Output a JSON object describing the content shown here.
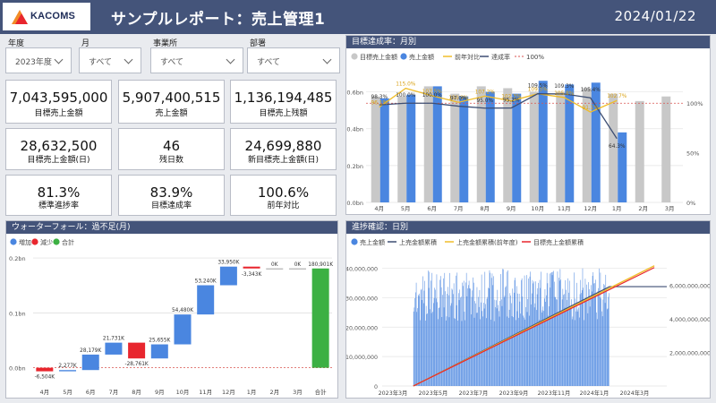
{
  "header": {
    "logo_text": "KACOMS",
    "title": "サンプルレポート：売上管理1",
    "date": "2024/01/22"
  },
  "filters": [
    {
      "label": "年度",
      "value": "2023年度"
    },
    {
      "label": "月",
      "value": "すべて"
    },
    {
      "label": "事業所",
      "value": "すべて"
    },
    {
      "label": "部署",
      "value": "すべて"
    }
  ],
  "kpis": [
    {
      "value": "7,043,595,000",
      "label": "目標売上金額"
    },
    {
      "value": "5,907,400,515",
      "label": "売上金額"
    },
    {
      "value": "1,136,194,485",
      "label": "目標売上残額"
    },
    {
      "value": "28,632,500",
      "label": "目標売上金額(日)"
    },
    {
      "value": "46",
      "label": "残日数"
    },
    {
      "value": "24,699,880",
      "label": "新目標売上金額(日)"
    },
    {
      "value": "81.3%",
      "label": "標準進捗率"
    },
    {
      "value": "83.9%",
      "label": "目標達成率"
    },
    {
      "value": "100.6%",
      "label": "前年対比"
    }
  ],
  "colors": {
    "header": "#44547a",
    "target_bar": "#c8c8c8",
    "sales_bar": "#4a86e0",
    "prev_year_line": "#f0bd2a",
    "achievement_line": "#3d4e73",
    "reference_line": "#d9534f",
    "increase": "#4a86e0",
    "decrease": "#e8262e",
    "total": "#3cb043",
    "cum_target": "#e8262e"
  },
  "panels": {
    "monthly": {
      "title": "目標達成率：月別"
    },
    "waterfall": {
      "title": "ウォーターフォール：過不足(月)"
    },
    "daily": {
      "title": "進捗確認：日別"
    }
  },
  "chart_data": [
    {
      "id": "monthly",
      "type": "bar",
      "title": "目標達成率：月別",
      "categories": [
        "4月",
        "5月",
        "6月",
        "7月",
        "8月",
        "9月",
        "10月",
        "11月",
        "12月",
        "1月",
        "2月",
        "3月"
      ],
      "series": [
        {
          "name": "目標売上金額",
          "type": "bar",
          "values": [
            0.575,
            0.575,
            0.63,
            0.59,
            0.63,
            0.62,
            0.6,
            0.6,
            0.62,
            0.59,
            0.55,
            0.575
          ]
        },
        {
          "name": "売上金額",
          "type": "bar",
          "values": [
            0.565,
            0.585,
            0.63,
            0.575,
            0.6,
            0.59,
            0.66,
            0.64,
            0.65,
            0.38,
            null,
            null
          ]
        },
        {
          "name": "前年対比",
          "type": "line",
          "axis": "right",
          "values": [
            96.1,
            115.0,
            107.5,
            100.9,
            107.2,
            102.3,
            109.5,
            105.8,
            91.1,
            102.7,
            null,
            null
          ]
        },
        {
          "name": "達成率",
          "type": "line",
          "axis": "right",
          "values": [
            98.3,
            100.0,
            100.0,
            97.0,
            95.0,
            95.2,
            109.5,
            109.3,
            105.4,
            64.3,
            null,
            null
          ]
        },
        {
          "name": "100%",
          "type": "reference",
          "axis": "right",
          "value": 100
        }
      ],
      "labels": {
        "prev_year": [
          "96.1%",
          "115.0%",
          "107.5%",
          "100.9%",
          "107.2%",
          "102.3%",
          "109.5%",
          "105.8%",
          "91.1%",
          "102.7%"
        ],
        "achievement": [
          "98.3%",
          "100.0%",
          "100.0%",
          "97.0%",
          "95.0%",
          "95.2%",
          "109.5%",
          "109.3%",
          "105.4%",
          "64.3%"
        ]
      },
      "y_ticks_left": [
        "0.0bn",
        "0.2bn",
        "0.4bn",
        "0.6bn"
      ],
      "y_ticks_right": [
        "0%",
        "50%",
        "100%"
      ],
      "ylim": [
        0,
        0.7
      ],
      "ylim_right": [
        0,
        130
      ]
    },
    {
      "id": "waterfall",
      "type": "bar",
      "title": "ウォーターフォール：過不足(月)",
      "categories": [
        "4月",
        "5月",
        "6月",
        "7月",
        "8月",
        "9月",
        "10月",
        "11月",
        "12月",
        "1月",
        "2月",
        "3月",
        "合計"
      ],
      "series": [
        {
          "name": "増加",
          "kind": "increase"
        },
        {
          "name": "減少",
          "kind": "decrease"
        },
        {
          "name": "合計",
          "kind": "total"
        }
      ],
      "values": [
        -6504,
        2277,
        28179,
        21731,
        -28761,
        25655,
        54480,
        53240,
        33950,
        -3343,
        0,
        0,
        180901
      ],
      "value_labels": [
        "-6,504K",
        "2,277K",
        "28,179K",
        "21,731K",
        "-28,761K",
        "25,655K",
        "54,480K",
        "53,240K",
        "33,950K",
        "-3,343K",
        "0K",
        "0K",
        "180,901K"
      ],
      "y_ticks": [
        "0.0bn",
        "0.1bn",
        "0.2bn"
      ],
      "ylim": [
        -30000,
        205000
      ]
    },
    {
      "id": "daily",
      "type": "bar",
      "title": "進捗確認：日別",
      "series": [
        {
          "name": "売上金額",
          "type": "bar",
          "axis": "right"
        },
        {
          "name": "上売金額累積",
          "type": "line"
        },
        {
          "name": "上売金額累積(前年度)",
          "type": "line"
        },
        {
          "name": "目標売上金額累積",
          "type": "line"
        }
      ],
      "left_ticks": [
        "0",
        "10,000,000",
        "20,000,000",
        "30,000,000",
        "40,000,000"
      ],
      "right_ticks": [
        "2,000,000,000",
        "4,000,000,000",
        "6,000,000,000"
      ],
      "x_ticks": [
        "2023年3月",
        "2023年5月",
        "2023年7月",
        "2023年9月",
        "2023年11月",
        "2024年1月",
        "2024年3月"
      ],
      "daily_sales_approx_range": [
        22000000,
        40000000
      ],
      "cumulative_end_values": {
        "sales": 5907400515,
        "target": 7043595000
      },
      "ylim_left": [
        0,
        42000000
      ],
      "ylim_right": [
        0,
        7350000000
      ]
    }
  ]
}
